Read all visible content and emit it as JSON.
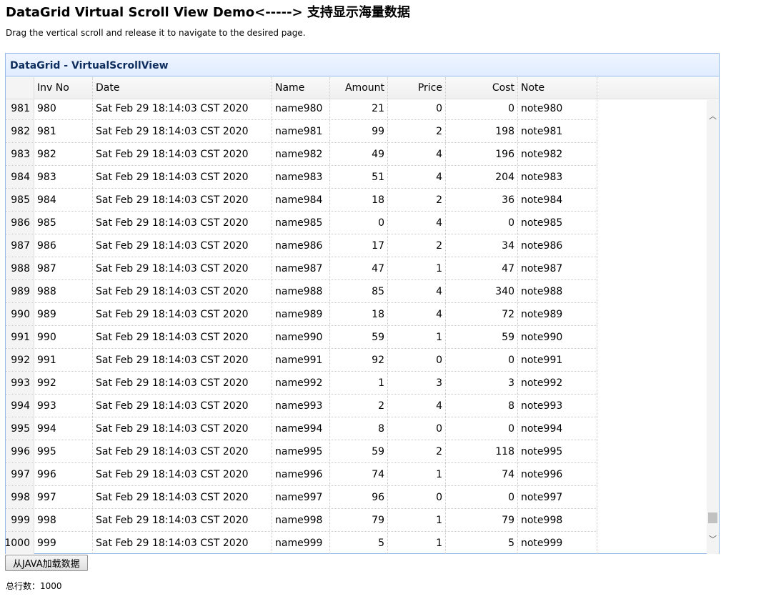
{
  "page": {
    "title": "DataGrid Virtual Scroll View Demo<-----> 支持显示海量数据",
    "description": "Drag the vertical scroll and release it to navigate to the desired page."
  },
  "panel": {
    "title": "DataGrid - VirtualScrollView"
  },
  "grid": {
    "columns": {
      "inv_no": "Inv No",
      "date": "Date",
      "name": "Name",
      "amount": "Amount",
      "price": "Price",
      "cost": "Cost",
      "note": "Note"
    },
    "rows": [
      {
        "rownum": "981",
        "inv_no": "980",
        "date": "Sat Feb 29 18:14:03 CST 2020",
        "name": "name980",
        "amount": "21",
        "price": "0",
        "cost": "0",
        "note": "note980"
      },
      {
        "rownum": "982",
        "inv_no": "981",
        "date": "Sat Feb 29 18:14:03 CST 2020",
        "name": "name981",
        "amount": "99",
        "price": "2",
        "cost": "198",
        "note": "note981"
      },
      {
        "rownum": "983",
        "inv_no": "982",
        "date": "Sat Feb 29 18:14:03 CST 2020",
        "name": "name982",
        "amount": "49",
        "price": "4",
        "cost": "196",
        "note": "note982"
      },
      {
        "rownum": "984",
        "inv_no": "983",
        "date": "Sat Feb 29 18:14:03 CST 2020",
        "name": "name983",
        "amount": "51",
        "price": "4",
        "cost": "204",
        "note": "note983"
      },
      {
        "rownum": "985",
        "inv_no": "984",
        "date": "Sat Feb 29 18:14:03 CST 2020",
        "name": "name984",
        "amount": "18",
        "price": "2",
        "cost": "36",
        "note": "note984"
      },
      {
        "rownum": "986",
        "inv_no": "985",
        "date": "Sat Feb 29 18:14:03 CST 2020",
        "name": "name985",
        "amount": "0",
        "price": "4",
        "cost": "0",
        "note": "note985"
      },
      {
        "rownum": "987",
        "inv_no": "986",
        "date": "Sat Feb 29 18:14:03 CST 2020",
        "name": "name986",
        "amount": "17",
        "price": "2",
        "cost": "34",
        "note": "note986"
      },
      {
        "rownum": "988",
        "inv_no": "987",
        "date": "Sat Feb 29 18:14:03 CST 2020",
        "name": "name987",
        "amount": "47",
        "price": "1",
        "cost": "47",
        "note": "note987"
      },
      {
        "rownum": "989",
        "inv_no": "988",
        "date": "Sat Feb 29 18:14:03 CST 2020",
        "name": "name988",
        "amount": "85",
        "price": "4",
        "cost": "340",
        "note": "note988"
      },
      {
        "rownum": "990",
        "inv_no": "989",
        "date": "Sat Feb 29 18:14:03 CST 2020",
        "name": "name989",
        "amount": "18",
        "price": "4",
        "cost": "72",
        "note": "note989"
      },
      {
        "rownum": "991",
        "inv_no": "990",
        "date": "Sat Feb 29 18:14:03 CST 2020",
        "name": "name990",
        "amount": "59",
        "price": "1",
        "cost": "59",
        "note": "note990"
      },
      {
        "rownum": "992",
        "inv_no": "991",
        "date": "Sat Feb 29 18:14:03 CST 2020",
        "name": "name991",
        "amount": "92",
        "price": "0",
        "cost": "0",
        "note": "note991"
      },
      {
        "rownum": "993",
        "inv_no": "992",
        "date": "Sat Feb 29 18:14:03 CST 2020",
        "name": "name992",
        "amount": "1",
        "price": "3",
        "cost": "3",
        "note": "note992"
      },
      {
        "rownum": "994",
        "inv_no": "993",
        "date": "Sat Feb 29 18:14:03 CST 2020",
        "name": "name993",
        "amount": "2",
        "price": "4",
        "cost": "8",
        "note": "note993"
      },
      {
        "rownum": "995",
        "inv_no": "994",
        "date": "Sat Feb 29 18:14:03 CST 2020",
        "name": "name994",
        "amount": "8",
        "price": "0",
        "cost": "0",
        "note": "note994"
      },
      {
        "rownum": "996",
        "inv_no": "995",
        "date": "Sat Feb 29 18:14:03 CST 2020",
        "name": "name995",
        "amount": "59",
        "price": "2",
        "cost": "118",
        "note": "note995"
      },
      {
        "rownum": "997",
        "inv_no": "996",
        "date": "Sat Feb 29 18:14:03 CST 2020",
        "name": "name996",
        "amount": "74",
        "price": "1",
        "cost": "74",
        "note": "note996"
      },
      {
        "rownum": "998",
        "inv_no": "997",
        "date": "Sat Feb 29 18:14:03 CST 2020",
        "name": "name997",
        "amount": "96",
        "price": "0",
        "cost": "0",
        "note": "note997"
      },
      {
        "rownum": "999",
        "inv_no": "998",
        "date": "Sat Feb 29 18:14:03 CST 2020",
        "name": "name998",
        "amount": "79",
        "price": "1",
        "cost": "79",
        "note": "note998"
      },
      {
        "rownum": "1000",
        "inv_no": "999",
        "date": "Sat Feb 29 18:14:03 CST 2020",
        "name": "name999",
        "amount": "5",
        "price": "1",
        "cost": "5",
        "note": "note999"
      }
    ]
  },
  "scrollbar": {
    "up_icon": "chevron-up-icon",
    "down_icon": "chevron-down-icon",
    "up_glyph": "︿",
    "down_glyph": "﹀",
    "position_fraction": 0.98
  },
  "toolbar": {
    "load_label": "从JAVA加载数据"
  },
  "status": {
    "total_rows_text": "总行数：1000"
  },
  "colors": {
    "panel_border": "#95b8e7",
    "panel_header_bg": "#e0ecff",
    "panel_title": "#0e2d5f"
  }
}
